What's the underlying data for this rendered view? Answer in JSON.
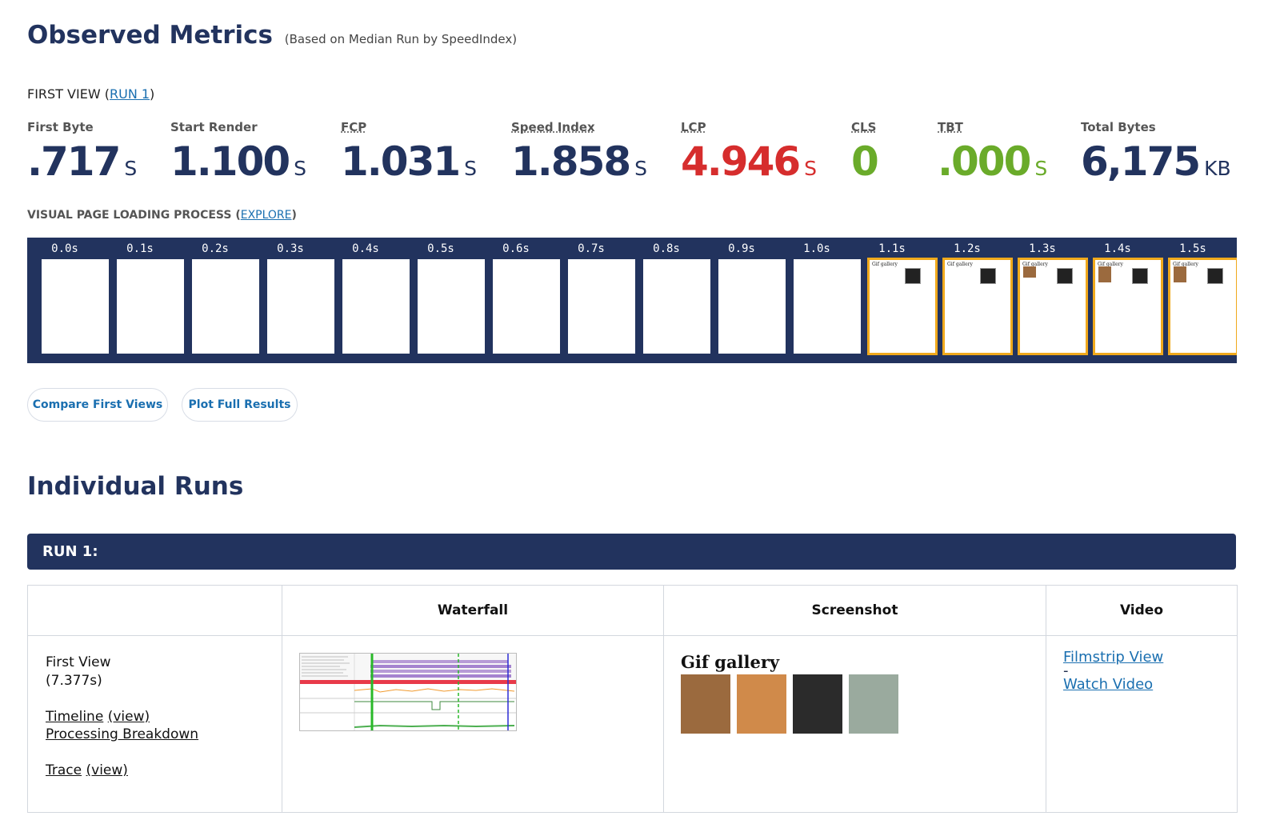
{
  "header": {
    "title": "Observed Metrics",
    "subtitle": "(Based on Median Run by SpeedIndex)"
  },
  "first_view": {
    "prefix": "FIRST VIEW (",
    "run_link": "RUN 1",
    "suffix": ")"
  },
  "metrics": [
    {
      "label": "First Byte",
      "value": ".717",
      "unit": "S",
      "color": "#22335e"
    },
    {
      "label": "Start Render",
      "value": "1.100",
      "unit": "S",
      "color": "#22335e"
    },
    {
      "label": "FCP",
      "value": "1.031",
      "unit": "S",
      "color": "#22335e"
    },
    {
      "label": "Speed Index",
      "value": "1.858",
      "unit": "S",
      "color": "#22335e"
    },
    {
      "label": "LCP",
      "value": "4.946",
      "unit": "S",
      "color": "#d62d2d"
    },
    {
      "label": "CLS",
      "value": "0",
      "unit": "",
      "color": "#6aab2a"
    },
    {
      "label": "TBT",
      "value": ".000",
      "unit": "S",
      "color": "#6aab2a"
    },
    {
      "label": "Total Bytes",
      "value": "6,175",
      "unit": "KB",
      "color": "#22335e"
    }
  ],
  "visual_progress": {
    "label": "VISUAL PAGE LOADING PROCESS",
    "open": "(",
    "link": "EXPLORE",
    "close": ")"
  },
  "filmstrip": {
    "frames": [
      "0.0s",
      "0.1s",
      "0.2s",
      "0.3s",
      "0.4s",
      "0.5s",
      "0.6s",
      "0.7s",
      "0.8s",
      "0.9s",
      "1.0s",
      "1.1s",
      "1.2s",
      "1.3s",
      "1.4s",
      "1.5s"
    ],
    "thumb_title": "Gif gallery"
  },
  "buttons": {
    "compare": "Compare First Views",
    "plot": "Plot Full Results"
  },
  "individual_runs": {
    "title": "Individual Runs",
    "run_label": "RUN 1:"
  },
  "table": {
    "headers": [
      "",
      "Waterfall",
      "Screenshot",
      "Video"
    ],
    "first_view_label": "First View",
    "first_view_time": "(7.377s)",
    "timeline": "Timeline",
    "timeline_view": "(view)",
    "processing": "Processing Breakdown",
    "trace": "Trace",
    "trace_view": "(view)",
    "screenshot_title": "Gif gallery",
    "filmstrip_view": "Filmstrip View",
    "separator": "-",
    "watch_video": "Watch Video"
  }
}
